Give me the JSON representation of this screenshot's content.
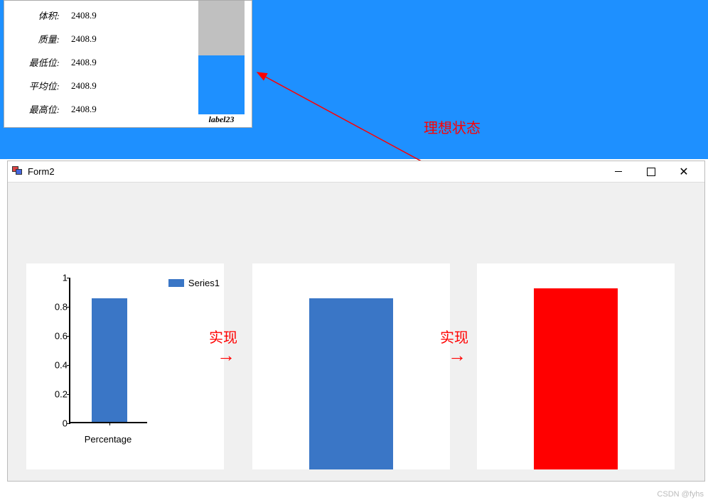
{
  "info_panel": {
    "rows": [
      {
        "label": "体积:",
        "value": "2408.9"
      },
      {
        "label": "质量:",
        "value": "2408.9"
      },
      {
        "label": "最低位:",
        "value": "2408.9"
      },
      {
        "label": "平均位:",
        "value": "2408.9"
      },
      {
        "label": "最高位:",
        "value": "2408.9"
      }
    ],
    "mini_bar_label": "label23",
    "mini_bar_fill_pct": 52
  },
  "annotations": {
    "ideal": "理想状态",
    "impl1": "实现",
    "impl2": "实现"
  },
  "form2": {
    "title": "Form2"
  },
  "chart_data": [
    {
      "type": "bar",
      "categories": [
        "Percentage"
      ],
      "values": [
        0.85
      ],
      "series_name": "Series1",
      "xlabel": "Percentage",
      "ylim": [
        0,
        1
      ],
      "yticks": [
        0,
        0.2,
        0.4,
        0.6,
        0.8,
        1
      ],
      "color": "#3a76c6"
    },
    {
      "type": "bar",
      "categories": [
        ""
      ],
      "values": [
        0.83
      ],
      "ylim": [
        0,
        1
      ],
      "color": "#3a76c6"
    },
    {
      "type": "bar",
      "categories": [
        ""
      ],
      "values": [
        0.88
      ],
      "ylim": [
        0,
        1
      ],
      "color": "#ff0000"
    }
  ],
  "watermark": "CSDN @fyhs"
}
